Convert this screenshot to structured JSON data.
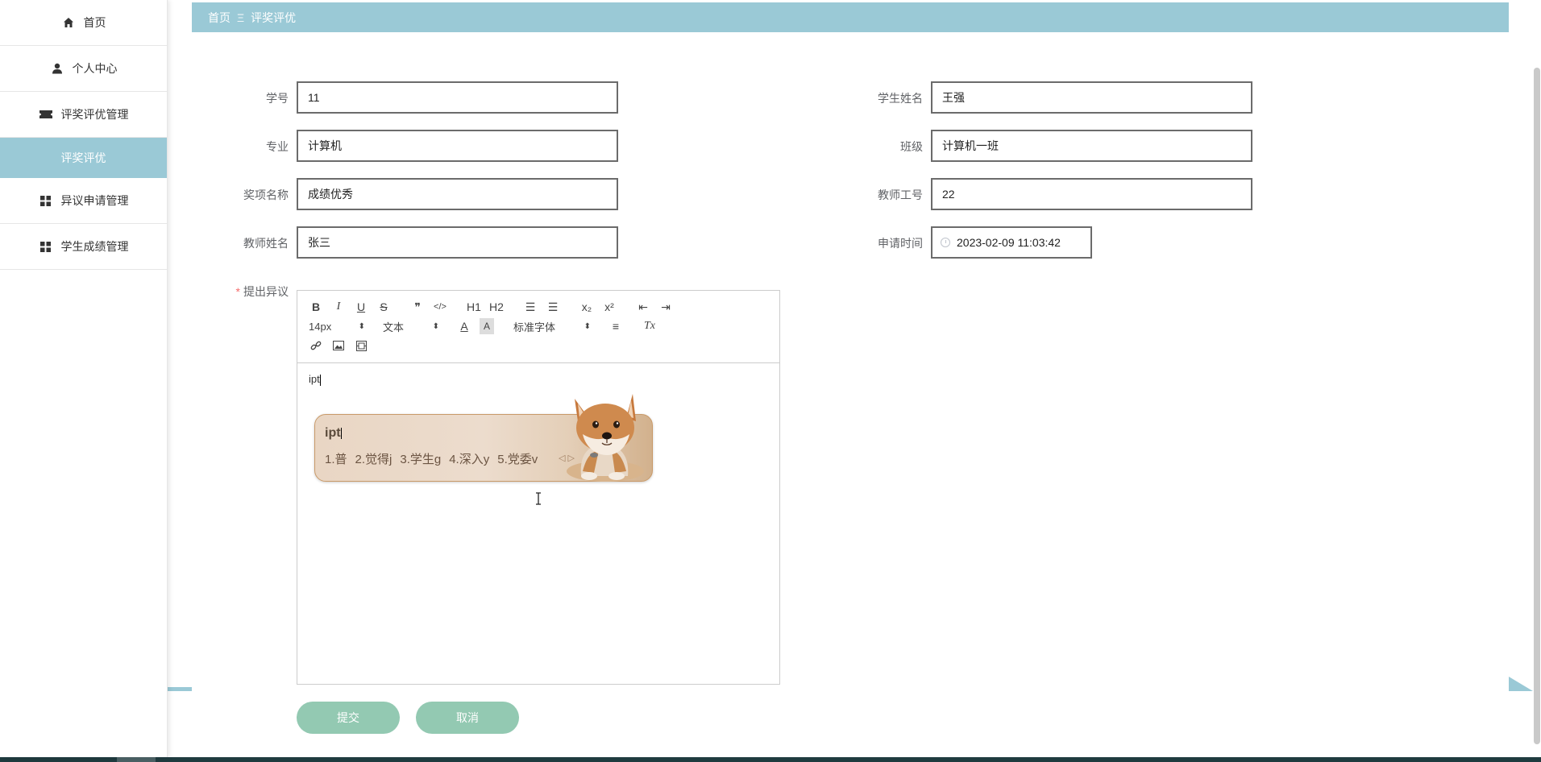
{
  "sidebar": {
    "items": [
      {
        "label": "首页",
        "icon": "home-icon"
      },
      {
        "label": "个人中心",
        "icon": "user-icon"
      },
      {
        "label": "评奖评优管理",
        "icon": "ticket-icon"
      },
      {
        "label": "评奖评优",
        "icon": ""
      },
      {
        "label": "异议申请管理",
        "icon": "grid-icon"
      },
      {
        "label": "学生成绩管理",
        "icon": "grid-icon"
      }
    ],
    "active_color": "#9ac9d6"
  },
  "breadcrumb": {
    "home": "首页",
    "separator": "Ξ",
    "current": "评奖评优"
  },
  "form": {
    "student_no": {
      "label": "学号",
      "value": "11"
    },
    "student_name": {
      "label": "学生姓名",
      "value": "王强"
    },
    "major": {
      "label": "专业",
      "value": "计算机"
    },
    "class_name": {
      "label": "班级",
      "value": "计算机一班"
    },
    "award_name": {
      "label": "奖项名称",
      "value": "成绩优秀"
    },
    "teacher_id": {
      "label": "教师工号",
      "value": "22"
    },
    "teacher_name": {
      "label": "教师姓名",
      "value": "张三"
    },
    "apply_time": {
      "label": "申请时间",
      "value": "2023-02-09 11:03:42"
    },
    "objection": {
      "label": "提出异议",
      "required_mark": "*"
    }
  },
  "editor": {
    "toolbar": {
      "bold": "B",
      "italic": "I",
      "underline": "U",
      "strike": "S",
      "quote": "❞",
      "code": "</>",
      "h1": "H1",
      "h2": "H2",
      "ordered_list": "☰",
      "bullet_list": "☰",
      "subscript": "x₂",
      "superscript": "x²",
      "indent_less": "⇤",
      "indent_more": "⇥",
      "font_size": "14px",
      "header_select": "文本",
      "font_color": "A",
      "bg_color": "A",
      "font_family": "标准字体",
      "align": "≡",
      "clear_format": "Tx",
      "select_arrow": "⬍"
    },
    "content": "ipt"
  },
  "ime": {
    "composition": "ipt",
    "candidates": [
      "1.普",
      "2.觉得j",
      "3.学生g",
      "4.深入y",
      "5.党委v"
    ],
    "more": "◁ ▷"
  },
  "buttons": {
    "submit": "提交",
    "cancel": "取消",
    "color": "#93c9b2"
  }
}
